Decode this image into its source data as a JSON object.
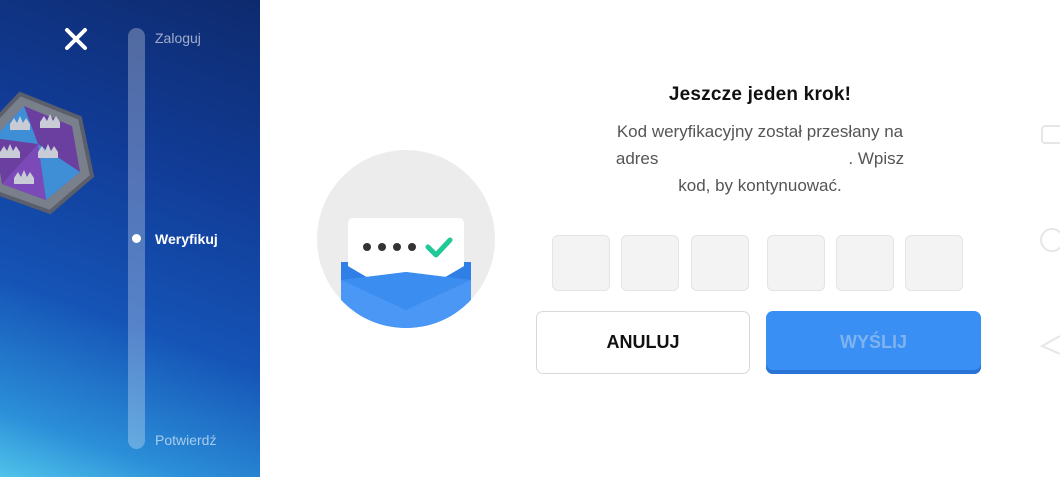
{
  "sidebar": {
    "steps": [
      {
        "label": "Zaloguj"
      },
      {
        "label": "Weryfikuj"
      },
      {
        "label": "Potwierdź"
      }
    ]
  },
  "main": {
    "title": "Jeszcze jeden krok!",
    "desc_line1": "Kod weryfikacyjny został przesłany na",
    "desc_line2_prefix": "adres",
    "desc_line2_suffix": ". Wpisz",
    "desc_line3": "kod, by kontynuować."
  },
  "buttons": {
    "cancel": "ANULUJ",
    "send": "WYŚLIJ"
  },
  "colors": {
    "accent": "#3a8ff5",
    "check": "#20c997"
  }
}
